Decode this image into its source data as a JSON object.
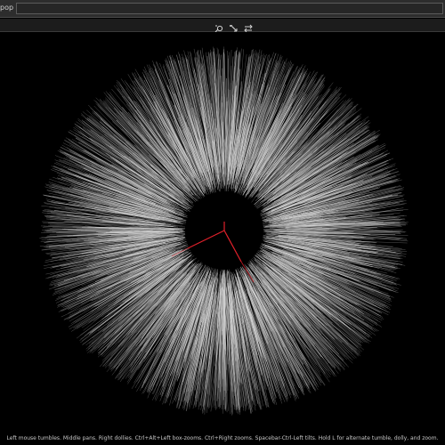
{
  "window": {
    "title_fragment": "pop"
  },
  "toolbar": {
    "buttons": [
      {
        "icon": "tumble-camera-icon"
      },
      {
        "icon": "dolly-camera-icon"
      },
      {
        "icon": "pan-camera-icon"
      }
    ]
  },
  "viewport": {
    "background": "#000000",
    "hair_color": "#d8d8d8",
    "axis_color": "#e0202a"
  },
  "status": {
    "hint": "Left mouse tumbles. Middle pans. Right dollies. Ctrl+Alt+Left box-zooms. Ctrl+Right zooms. Spacebar-Ctrl-Left tilts. Hold L for alternate tumble, dolly, and zoom."
  }
}
